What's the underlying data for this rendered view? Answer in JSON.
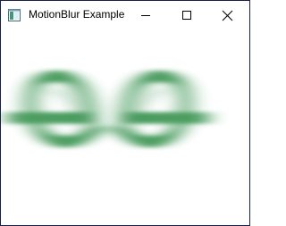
{
  "window": {
    "title": "MotionBlur Example",
    "icon": "app-window-icon",
    "controls": {
      "minimize_icon": "minimize-icon",
      "maximize_icon": "maximize-icon",
      "close_icon": "close-icon"
    }
  },
  "content": {
    "logo_icon": "blurred-gfg-logo",
    "logo_color": "#2f8d46",
    "background": "#ffffff"
  }
}
